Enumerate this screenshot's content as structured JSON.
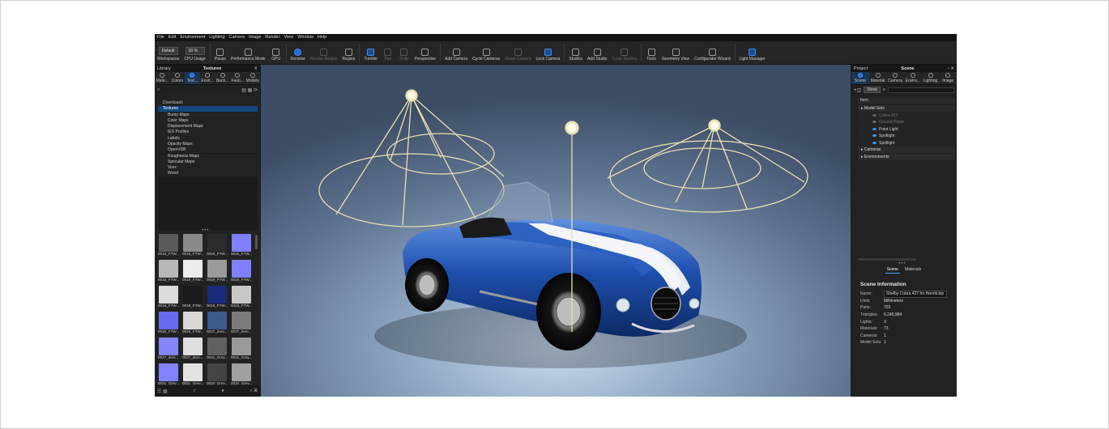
{
  "menu": [
    "File",
    "Edit",
    "Environment",
    "Lighting",
    "Camera",
    "Image",
    "Render",
    "View",
    "Window",
    "Help"
  ],
  "toolbar": {
    "workspace_value": "Default",
    "cpu_value": "50 %",
    "items": [
      {
        "label": "Workspaces",
        "icon": "workspaces-icon",
        "state": "normal"
      },
      {
        "label": "CPU Usage",
        "icon": "cpu-icon",
        "state": "normal"
      },
      {
        "label": "Pause",
        "icon": "pause-icon",
        "state": "normal"
      },
      {
        "label": "Performance Mode",
        "icon": "performance-icon",
        "state": "normal"
      },
      {
        "label": "GPU",
        "icon": "gpu-icon",
        "state": "normal"
      },
      {
        "label": "Denoise",
        "icon": "denoise-icon",
        "state": "active"
      },
      {
        "label": "Render Region",
        "icon": "render-region-icon",
        "state": "dim"
      },
      {
        "label": "Region",
        "icon": "region-icon",
        "state": "normal"
      },
      {
        "label": "Tumble",
        "icon": "tumble-icon",
        "state": "selected"
      },
      {
        "label": "Pan",
        "icon": "pan-icon",
        "state": "dim"
      },
      {
        "label": "Dolly",
        "icon": "dolly-icon",
        "state": "dim"
      },
      {
        "label": "Perspective",
        "icon": "perspective-icon",
        "state": "normal"
      },
      {
        "label": "Add Camera",
        "icon": "add-camera-icon",
        "state": "normal"
      },
      {
        "label": "Cycle Cameras",
        "icon": "cycle-cameras-icon",
        "state": "normal"
      },
      {
        "label": "Reset Camera",
        "icon": "reset-camera-icon",
        "state": "dim"
      },
      {
        "label": "Lock Camera",
        "icon": "lock-camera-icon",
        "state": "selected"
      },
      {
        "label": "Studios",
        "icon": "studios-icon",
        "state": "normal"
      },
      {
        "label": "Add Studio",
        "icon": "add-studio-icon",
        "state": "normal"
      },
      {
        "label": "Cycle Studios",
        "icon": "cycle-studios-icon",
        "state": "dim"
      },
      {
        "label": "Tools",
        "icon": "tools-icon",
        "state": "normal"
      },
      {
        "label": "Geometry View",
        "icon": "geometry-view-icon",
        "state": "normal"
      },
      {
        "label": "Configurator Wizard",
        "icon": "configurator-icon",
        "state": "normal"
      },
      {
        "label": "Light Manager",
        "icon": "light-manager-icon",
        "state": "selected"
      }
    ],
    "zoom_label": "25 2"
  },
  "library": {
    "panel_title": "Library",
    "tab_title": "Textures",
    "tabs": [
      "Mate...",
      "Colors",
      "Text...",
      "Envir...",
      "Back...",
      "Favo...",
      "Models"
    ],
    "active_tab": 2,
    "tree": [
      {
        "label": "Downloads",
        "style": "italic",
        "indent": 0
      },
      {
        "label": "Textures",
        "style": "selected",
        "indent": 0
      },
      {
        "label": "Bump Maps",
        "style": "normal",
        "indent": 1
      },
      {
        "label": "Color Maps",
        "style": "normal",
        "indent": 1
      },
      {
        "label": "Displacement Maps",
        "style": "normal",
        "indent": 1
      },
      {
        "label": "IES Profiles",
        "style": "normal",
        "indent": 1
      },
      {
        "label": "Labels",
        "style": "normal",
        "indent": 1
      },
      {
        "label": "Opacity Maps",
        "style": "normal",
        "indent": 1
      },
      {
        "label": "OpenVDB",
        "style": "normal",
        "indent": 1
      },
      {
        "label": "Roughness Maps",
        "style": "normal",
        "indent": 1
      },
      {
        "label": "Specular Maps",
        "style": "normal",
        "indent": 1
      },
      {
        "label": "Voxx",
        "style": "normal",
        "indent": 1
      },
      {
        "label": "Wood",
        "style": "normal",
        "indent": 1
      }
    ],
    "thumbnails": [
      {
        "caption": "0016_FTW...",
        "color": "#5a5a5a"
      },
      {
        "caption": "0016_FTW...",
        "color": "#8a8a8a"
      },
      {
        "caption": "0016_FTW...",
        "color": "#2c2c2c"
      },
      {
        "caption": "0016_FTW...",
        "color": "#7f7fff"
      },
      {
        "caption": "0016_FTW...",
        "color": "#b9b9b9"
      },
      {
        "caption": "0019_FTW...",
        "color": "#ececec"
      },
      {
        "caption": "0019_FTW...",
        "color": "#9a9a9a"
      },
      {
        "caption": "0019_FTW...",
        "color": "#8080ff"
      },
      {
        "caption": "0019_FTW...",
        "color": "#dcdcdc"
      },
      {
        "caption": "0019_FTW...",
        "color": "#1a1a1a"
      },
      {
        "caption": "0019_FTW...",
        "color": "#1b2a7a"
      },
      {
        "caption": "0019_FTW...",
        "color": "#c8c8c8"
      },
      {
        "caption": "0026_FTW...",
        "color": "#6a6af0"
      },
      {
        "caption": "0026_FTW...",
        "color": "#d8d8d8"
      },
      {
        "caption": "0027_deni...",
        "color": "#3c5a8a"
      },
      {
        "caption": "0027_deni...",
        "color": "#7a7a7a"
      },
      {
        "caption": "0027_deni...",
        "color": "#8585ff"
      },
      {
        "caption": "0027_deni...",
        "color": "#dedede"
      },
      {
        "caption": "0031_Grey...",
        "color": "#606060"
      },
      {
        "caption": "0031_Grey...",
        "color": "#9a9a9a"
      },
      {
        "caption": "0031_Grey...",
        "color": "#8282ff"
      },
      {
        "caption": "0031_Grey...",
        "color": "#e2e2e2"
      },
      {
        "caption": "0034_Grey...",
        "color": "#444444"
      },
      {
        "caption": "0034_Grey...",
        "color": "#a0a0a0"
      },
      {
        "caption": "0034_Grey...",
        "color": "#8080ff"
      },
      {
        "caption": "0034_Grey...",
        "color": "#e4e4e4"
      },
      {
        "caption": "0042-dar...",
        "color": "#5a2e1e"
      },
      {
        "caption": "05_Menu...",
        "color": "#f0d8e4"
      }
    ]
  },
  "scene": {
    "panel_left": "Project",
    "panel_title": "Scene",
    "tabs": [
      "Scene",
      "Material",
      "Camera",
      "Enviro...",
      "Lighting",
      "Image"
    ],
    "active_tab": 0,
    "show_label": "Show",
    "column_header": "Item",
    "tree": [
      {
        "label": "Model Sets",
        "level": 0,
        "type": "header",
        "eye": false
      },
      {
        "label": "Cobra 427",
        "level": 1,
        "type": "dim",
        "eye": true
      },
      {
        "label": "Ground Plane",
        "level": 1,
        "type": "dim",
        "eye": true
      },
      {
        "label": "Point Light",
        "level": 1,
        "type": "normal",
        "eye": true
      },
      {
        "label": "Spotlight",
        "level": 1,
        "type": "normal",
        "eye": true
      },
      {
        "label": "Spotlight",
        "level": 1,
        "type": "normal",
        "eye": true
      },
      {
        "label": "Cameras",
        "level": 0,
        "type": "header",
        "eye": false
      },
      {
        "label": "Environments",
        "level": 0,
        "type": "header",
        "eye": false
      }
    ],
    "subtabs": [
      "Scene",
      "Materials"
    ],
    "info": {
      "heading": "Scene Information",
      "rows": [
        {
          "k": "Name:",
          "v": "Shelby Cobra 427 for Henrik.bip",
          "boxed": true
        },
        {
          "k": "Units:",
          "v": "Millimeters",
          "boxed": false
        },
        {
          "k": "Parts:",
          "v": "703",
          "boxed": false
        },
        {
          "k": "Triangles:",
          "v": "6,245,984",
          "boxed": false
        },
        {
          "k": "Lights:",
          "v": "3",
          "boxed": false
        },
        {
          "k": "Materials:",
          "v": "73",
          "boxed": false
        },
        {
          "k": "Cameras:",
          "v": "1",
          "boxed": false
        },
        {
          "k": "Model Sets:",
          "v": "1",
          "boxed": false
        }
      ]
    }
  },
  "viewport": {
    "car_color": "#1e4fae",
    "stripe_color": "#f2f4f8",
    "light_gizmo_color": "#e8e2b0"
  }
}
